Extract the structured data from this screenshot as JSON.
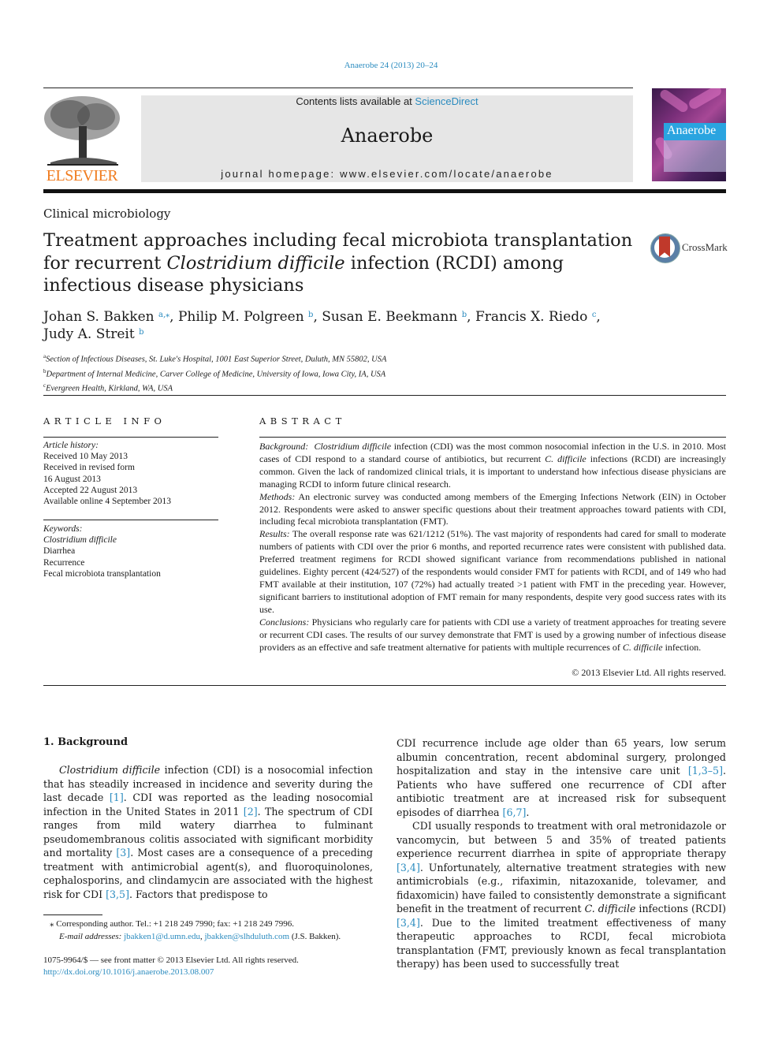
{
  "header": {
    "citation": "Anaerobe 24 (2013) 20–24",
    "contents_prefix": "Contents lists available at ",
    "sciencedirect_link": "ScienceDirect",
    "journal_name": "Anaerobe",
    "homepage_prefix": "journal homepage: ",
    "homepage_url": "www.elsevier.com/locate/anaerobe",
    "publisher_wordmark": "ELSEVIER",
    "cover_title": "Anaerobe",
    "crossmark_label": "CrossMark",
    "colors": {
      "link": "#2a8bbf",
      "elsevier_orange": "#f07c1f",
      "cover_band": "#2aa4e0",
      "masthead_bg": "#e6e6e6"
    }
  },
  "article": {
    "section": "Clinical microbiology",
    "title_part1": "Treatment approaches including fecal microbiota transplantation for recurrent ",
    "title_italic": "Clostridium difficile",
    "title_part2": " infection (RCDI) among infectious disease physicians",
    "authors": [
      {
        "name": "Johan S. Bakken",
        "aff": "a,⁎",
        "sep": ", "
      },
      {
        "name": "Philip M. Polgreen",
        "aff": "b",
        "sep": ", "
      },
      {
        "name": "Susan E. Beekmann",
        "aff": "b",
        "sep": ", "
      },
      {
        "name": "Francis X. Riedo",
        "aff": "c",
        "sep": ","
      },
      {
        "name": "Judy A. Streit",
        "aff": "b",
        "sep": ""
      }
    ],
    "affiliations": [
      {
        "mark": "a",
        "text": "Section of Infectious Diseases, St. Luke's Hospital, 1001 East Superior Street, Duluth, MN 55802, USA"
      },
      {
        "mark": "b",
        "text": "Department of Internal Medicine, Carver College of Medicine, University of Iowa, Iowa City, IA, USA"
      },
      {
        "mark": "c",
        "text": "Evergreen Health, Kirkland, WA, USA"
      }
    ]
  },
  "article_info": {
    "heading": "ARTICLE INFO",
    "history_label": "Article history:",
    "history": [
      "Received 10 May 2013",
      "Received in revised form",
      "16 August 2013",
      "Accepted 22 August 2013",
      "Available online 4 September 2013"
    ],
    "keywords_label": "Keywords:",
    "keywords": [
      "Clostridium difficile",
      "Diarrhea",
      "Recurrence",
      "Fecal microbiota transplantation"
    ]
  },
  "abstract": {
    "heading": "ABSTRACT",
    "background_label": "Background:",
    "background_italic": "Clostridium difficile",
    "background_a": " infection (CDI) was the most common nosocomial infection in the U.S. in 2010. Most cases of CDI respond to a standard course of antibiotics, but recurrent ",
    "background_italic2": "C. difficile",
    "background_b": " infections (RCDI) are increasingly common. Given the lack of randomized clinical trials, it is important to understand how infectious disease physicians are managing RCDI to inform future clinical research.",
    "methods_label": "Methods:",
    "methods": " An electronic survey was conducted among members of the Emerging Infections Network (EIN) in October 2012. Respondents were asked to answer specific questions about their treatment approaches toward patients with CDI, including fecal microbiota transplantation (FMT).",
    "results_label": "Results:",
    "results": " The overall response rate was 621/1212 (51%). The vast majority of respondents had cared for small to moderate numbers of patients with CDI over the prior 6 months, and reported recurrence rates were consistent with published data. Preferred treatment regimens for RCDI showed significant variance from recommendations published in national guidelines. Eighty percent (424/527) of the respondents would consider FMT for patients with RCDI, and of 149 who had FMT available at their institution, 107 (72%) had actually treated >1 patient with FMT in the preceding year. However, significant barriers to institutional adoption of FMT remain for many respondents, despite very good success rates with its use.",
    "conclusions_label": "Conclusions:",
    "conclusions_a": " Physicians who regularly care for patients with CDI use a variety of treatment approaches for treating severe or recurrent CDI cases. The results of our survey demonstrate that FMT is used by a growing number of infectious disease providers as an effective and safe treatment alternative for patients with multiple recurrences of ",
    "conclusions_italic": "C. difficile",
    "conclusions_b": " infection.",
    "copyright": "© 2013 Elsevier Ltd. All rights reserved."
  },
  "body": {
    "section_heading": "1.  Background",
    "p1": {
      "italic": "Clostridium difficile",
      "t1": " infection (CDI) is a nosocomial infection that has steadily increased in incidence and severity during the last decade ",
      "r1": "[1]",
      "t2": ". CDI was reported as the leading nosocomial infection in the United States in 2011 ",
      "r2": "[2]",
      "t3": ". The spectrum of CDI ranges from mild watery diarrhea to fulminant pseudomembranous colitis associated with significant morbidity and mortality ",
      "r3": "[3]",
      "t4": ". Most cases are a consequence of a preceding treatment with antimicrobial agent(s), and fluoroquinolones, cephalosporins, and clindamycin are associated with the highest risk for CDI ",
      "r4": "[3,5]",
      "t5": ". Factors that predispose to CDI recurrence include age older than 65 years, low serum albumin concentration, recent abdominal surgery, prolonged hospitalization and stay in the intensive care unit ",
      "r5": "[1,3–5]",
      "t6": ". Patients who have suffered one recurrence of CDI after antibiotic treatment are at increased risk for subsequent episodes of diarrhea ",
      "r6": "[6,7]",
      "t7": "."
    },
    "p2": {
      "t1": "CDI usually responds to treatment with oral metronidazole or vancomycin, but between 5 and 35% of treated patients experience recurrent diarrhea in spite of appropriate therapy ",
      "r1": "[3,4]",
      "t2": ". Unfortunately, alternative treatment strategies with new antimicrobials (e.g., rifaximin, nitazoxanide, tolevamer, and fidaxomicin) have failed to consistently demonstrate a significant benefit in the treatment of recurrent ",
      "italic": "C. difficile",
      "t3": " infections (RCDI) ",
      "r2": "[3,4]",
      "t4": ". Due to the limited treatment effectiveness of many therapeutic approaches to RCDI, fecal microbiota transplantation (FMT, previously known as fecal transplantation therapy) has been used to successfully treat"
    }
  },
  "footnotes": {
    "corresponding": "⁎  Corresponding author. Tel.: +1 218 249 7990; fax: +1 218 249 7996.",
    "email_label": "E-mail addresses:",
    "email1": "jbakken1@d.umn.edu",
    "email2": "jbakken@slhduluth.com",
    "email_suffix": " (J.S. Bakken).",
    "front_matter": "1075-9964/$ — see front matter © 2013 Elsevier Ltd. All rights reserved.",
    "doi": "http://dx.doi.org/10.1016/j.anaerobe.2013.08.007"
  }
}
